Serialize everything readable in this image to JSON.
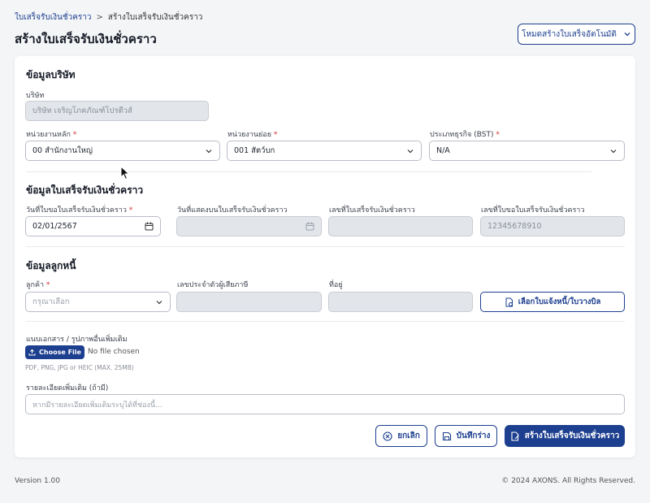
{
  "breadcrumb": {
    "parent": "ใบเสร็จรับเงินชั่วคราว",
    "separator": ">",
    "current": "สร้างใบเสร็จรับเงินชั่วคราว"
  },
  "page_title": "สร้างใบเสร็จรับเงินชั่วคราว",
  "mode_button": {
    "label": "โหมดสร้างใบเสร็จอัตโนมัติ",
    "icon": "chevron-down-icon"
  },
  "company_section": {
    "title": "ข้อมูลบริษัท",
    "company_label": "บริษัท",
    "company_value": "บริษัท เจริญโภคภัณฑ์โปรตีวส์",
    "main_unit_label": "หน่วยงานหลัก",
    "main_unit_value": "00 สำนักงานใหญ่",
    "sub_unit_label": "หน่วยงานย่อย",
    "sub_unit_value": "001 สัตว์บก",
    "business_type_label": "ประเภทธุรกิจ (BST)",
    "business_type_value": "N/A",
    "required_mark": "*"
  },
  "receipt_section": {
    "title": "ข้อมูลใบเสร็จรับเงินชั่วคราว",
    "request_date_label": "วันที่ใบขอใบเสร็จรับเงินชั่วคราว",
    "request_date_value": "02/01/2567",
    "display_date_label": "วันที่แสดงบนใบเสร็จรับเงินชั่วคราว",
    "display_date_value": "",
    "receipt_no_label": "เลขที่ใบเสร็จรับเงินชั่วคราว",
    "receipt_no_value": "",
    "request_no_label": "เลขที่ใบขอใบเสร็จรับเงินชั่วคราว",
    "request_no_value": "12345678910"
  },
  "debtor_section": {
    "title": "ข้อมูลลูกหนี้",
    "customer_label": "ลูกค้า",
    "customer_placeholder": "กรุณาเลือก",
    "tax_id_label": "เลขประจำตัวผู้เสียภาษี",
    "address_label": "ที่อยู่",
    "pick_button_label": "เลือกใบแจ้งหนี้/ใบวางบิล"
  },
  "attachments": {
    "label": "แนบเอกสาร / รูปภาพอื่นเพิ่มเติม",
    "choose_file_label": "Choose File",
    "no_file_text": "No file chosen",
    "hint": "PDF, PNG, JPG or HEIC (MAX. 25MB)"
  },
  "details": {
    "label": "รายละเอียดเพิ่มเติม (ถ้ามี)",
    "placeholder": "หากมีรายละเอียดเพิ่มเติมระบุได้ที่ช่องนี้..."
  },
  "actions": {
    "cancel_label": "ยกเลิก",
    "save_draft_label": "บันทึกร่าง",
    "create_label": "สร้างใบเสร็จรับเงินชั่วคราว"
  },
  "footer": {
    "version": "Version 1.00",
    "copyright": "© 2024 AXONS. All Rights Reserved."
  },
  "colors": {
    "primary": "#1d3f8f",
    "required": "#d32f2f",
    "disabled_bg": "#e2e5ea"
  }
}
